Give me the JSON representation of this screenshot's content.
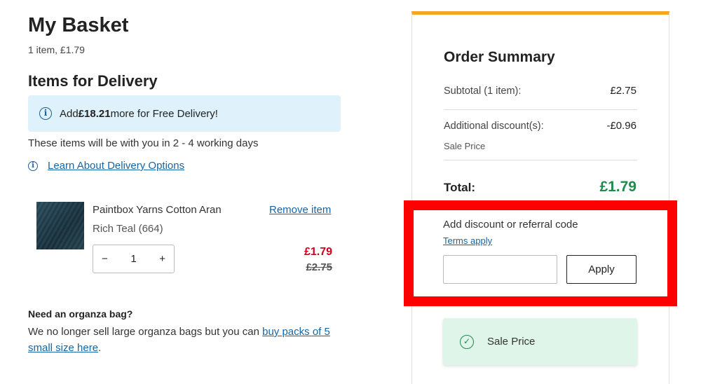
{
  "basket": {
    "title": "My Basket",
    "summary": "1 item, £1.79"
  },
  "delivery": {
    "section_title": "Items for Delivery",
    "banner_prefix": "Add ",
    "banner_amount": "£18.21",
    "banner_suffix": " more for Free Delivery!",
    "note": "These items will be with you in 2 - 4 working days",
    "options_link": "Learn About Delivery Options"
  },
  "item": {
    "name": "Paintbox Yarns Cotton Aran",
    "variant": "Rich Teal (664)",
    "remove_label": "Remove item",
    "quantity": "1",
    "decrement": "−",
    "increment": "+",
    "price_now": "£1.79",
    "price_was": "£2.75"
  },
  "organza": {
    "title": "Need an organza bag?",
    "text": "We no longer sell large organza bags but you can ",
    "link": "buy packs of 5 small size here",
    "text_end": "."
  },
  "order_summary": {
    "title": "Order Summary",
    "subtotal_label": "Subtotal (1 item):",
    "subtotal_value": "£2.75",
    "discount_label": "Additional discount(s):",
    "discount_value": "-£0.96",
    "discount_sub": "Sale Price",
    "total_label": "Total:",
    "total_value": "£1.79"
  },
  "discount_code": {
    "label": "Add discount or referral code",
    "terms_link": "Terms apply",
    "input_value": "",
    "input_placeholder": "",
    "apply_label": "Apply"
  },
  "applied_promo": {
    "label": "Sale Price"
  },
  "colors": {
    "accent_bar": "#f5a623",
    "total_green": "#1f8a4c",
    "sale_red": "#d0021b",
    "link_blue": "#1565a6",
    "highlight": "#ff0000"
  }
}
